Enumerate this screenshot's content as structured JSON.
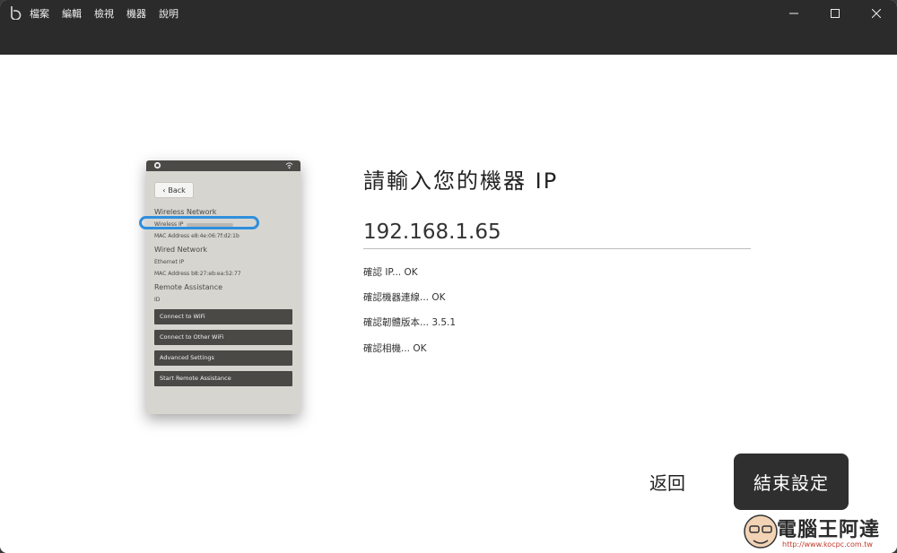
{
  "menu": [
    "檔案",
    "編輯",
    "檢視",
    "機器",
    "說明"
  ],
  "device": {
    "back": "Back",
    "wireless_title": "Wireless Network",
    "wireless_ip": "Wireless IP",
    "mac1": "MAC Address e8:4e:06:7f:d2:1b",
    "wired_title": "Wired Network",
    "ethernet_ip": "Ethernet IP",
    "mac2": "MAC Address b8:27:eb:ea:52:77",
    "remote_title": "Remote Assistance",
    "id_label": "ID",
    "buttons": [
      "Connect to WiFi",
      "Connect to Other WiFi",
      "Advanced Settings",
      "Start Remote Assistance"
    ]
  },
  "main": {
    "heading": "請輸入您的機器 IP",
    "ip_value": "192.168.1.65",
    "status": [
      "確認 IP... OK",
      "確認機器連線... OK",
      "確認韌體版本... 3.5.1",
      "確認相機... OK"
    ]
  },
  "footer": {
    "back": "返回",
    "finish": "結束設定"
  },
  "watermark": {
    "name": "電腦王阿達",
    "url": "http://www.kocpc.com.tw"
  },
  "colors": {
    "titlebar": "#2b2b2b",
    "highlight": "#2f8fdc",
    "button_dark": "#2f2f2f"
  }
}
